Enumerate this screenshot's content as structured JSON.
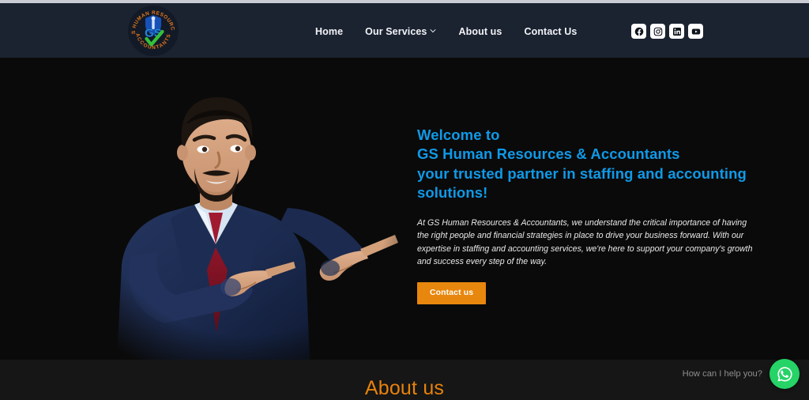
{
  "site": {
    "logo": {
      "top_arc_text": "GS HUMAN RESOURCES",
      "bottom_arc_text": "ACCOUNTANTS",
      "center_text": "GS",
      "icon": "shield-check-logo"
    }
  },
  "header": {
    "background_color": "#1b2230",
    "nav": [
      {
        "label": "Home",
        "has_dropdown": false
      },
      {
        "label": "Our Services",
        "has_dropdown": true
      },
      {
        "label": "About us",
        "has_dropdown": false
      },
      {
        "label": "Contact Us",
        "has_dropdown": false
      }
    ],
    "socials": [
      {
        "name": "facebook",
        "icon": "facebook-icon"
      },
      {
        "name": "instagram",
        "icon": "instagram-icon"
      },
      {
        "name": "linkedin",
        "icon": "linkedin-icon"
      },
      {
        "name": "youtube",
        "icon": "youtube-icon"
      }
    ]
  },
  "hero": {
    "background_color": "#0a0a0a",
    "image_alt": "businessman-pointing-right",
    "heading_color": "#0f9ae8",
    "heading_lines": [
      "Welcome to",
      "GS Human Resources & Accountants",
      "your trusted partner in staffing and accounting",
      "solutions!"
    ],
    "paragraph": "At GS Human Resources & Accountants, we understand the critical importance of having the right people and financial strategies in place to drive your business forward. With our expertise in staffing and accounting services, we're here to support your company's growth and success every step of the way.",
    "cta": {
      "label": "Contact us",
      "background_color": "#e8870d",
      "text_color": "#ffffff"
    }
  },
  "about_section": {
    "title": "About us",
    "title_color": "#e8820c",
    "background_color": "#161616"
  },
  "whatsapp_widget": {
    "tooltip": "How can I help you?",
    "button_color": "#25d366",
    "icon": "whatsapp-icon"
  }
}
